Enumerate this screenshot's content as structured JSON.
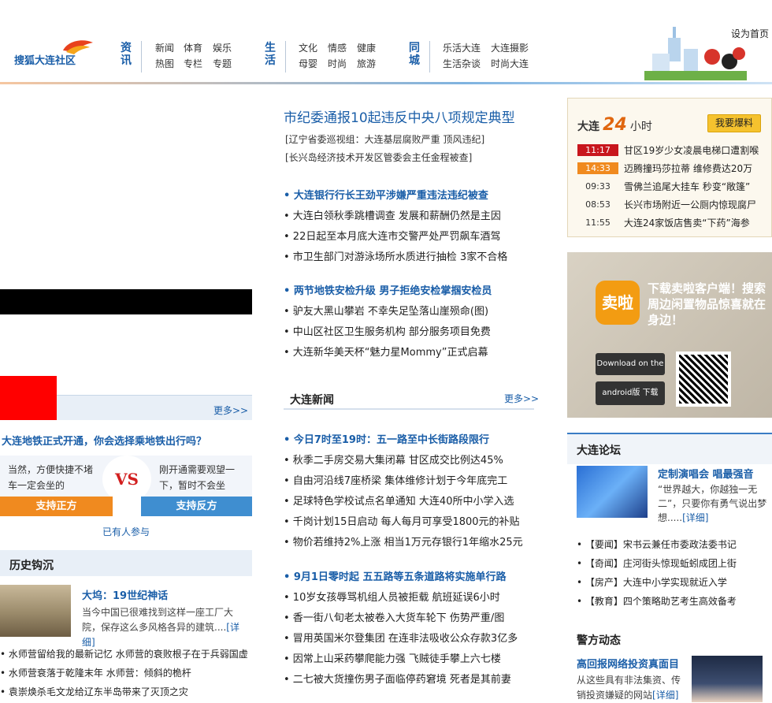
{
  "header": {
    "set_home": "设为首页",
    "logo_text": "搜狐大连社区",
    "categories": [
      {
        "title": "资讯",
        "links": [
          "新闻",
          "体育",
          "娱乐",
          "热图",
          "专栏",
          "专题"
        ]
      },
      {
        "title": "生活",
        "links": [
          "文化",
          "情感",
          "健康",
          "母婴",
          "时尚",
          "旅游"
        ]
      },
      {
        "title": "同城",
        "links": [
          "乐活大连",
          "大连摄影",
          "生活杂谈",
          "时尚大连"
        ]
      }
    ]
  },
  "poll": {
    "more": "更多>>",
    "question": "大连地铁正式开通，你会选择乘地铁出行吗？",
    "option_a": "当然，方便快捷不堵车一定会坐的",
    "option_b": "刚开通需要观望一下，暂时不会坐",
    "vs": "VS",
    "btn_pro": "支持正方",
    "btn_con": "支持反方",
    "count": "已有人参与"
  },
  "history": {
    "title": "历史钩沉",
    "head": "大坞：19世纪神话",
    "desc": "当今中国已很难找到这样一座工厂大院，保存这么多风格各异的建筑....",
    "detail": "[详细]",
    "items": [
      "• 水师营留给我的最新记忆 水师营的衰败根子在于兵弱国虚",
      "• 水师营衰落于乾隆末年 水师营：倾斜的桅杆",
      "• 袁崇焕杀毛文龙给辽东半岛带来了灭顶之灾"
    ]
  },
  "main": {
    "headline": "市纪委通报10起违反中央八项规定典型",
    "subs": [
      "[辽宁省委巡视组：大连基层腐败严重 顶风违纪]",
      "[长兴岛经济技术开发区管委会主任金程被查]"
    ],
    "group1": [
      {
        "text": "• 大连银行行长王劲平涉嫌严重违法违纪被查",
        "hl": true
      },
      {
        "text": "• 大连白领秋季跳槽调查 发展和薪酬仍然是主因",
        "hl": false
      },
      {
        "text": "• 22日起至本月底大连市交警严处严罚飙车酒驾",
        "hl": false
      },
      {
        "text": "• 市卫生部门对游泳场所水质进行抽检 3家不合格",
        "hl": false
      }
    ],
    "group2": [
      {
        "text": "• 两节地铁安检升级 男子拒绝安检掌掴安检员",
        "hl": true
      },
      {
        "text": "• 驴友大黑山攀岩 不幸失足坠落山崖殒命(图)",
        "hl": false
      },
      {
        "text": "• 中山区社区卫生服务机构 部分服务项目免费",
        "hl": false
      },
      {
        "text": "• 大连新华美天杯“魅力星Mommy”正式启幕",
        "hl": false
      }
    ],
    "dalian_news_title": "大连新闻",
    "dalian_news_more": "更多>>",
    "group3": [
      {
        "text": "• 今日7时至19时：五一路至中长街路段限行",
        "hl": true
      },
      {
        "text": "• 秋季二手房交易大集闭幕 甘区成交比例达45%",
        "hl": false
      },
      {
        "text": "• 自由河沿线7座桥梁 集体维修计划于今年底完工",
        "hl": false
      },
      {
        "text": "• 足球特色学校试点名单通知 大连40所中小学入选",
        "hl": false
      },
      {
        "text": "• 千岗计划15日启动 每人每月可享受1800元的补贴",
        "hl": false
      },
      {
        "text": "• 物价若维持2%上涨 相当1万元存银行1年缩水25元",
        "hl": false
      }
    ],
    "group4": [
      {
        "text": "• 9月1日零时起 五五路等五条道路将实施单行路",
        "hl": true
      },
      {
        "text": "• 10岁女孩辱骂机组人员被拒载 航班延误6小时",
        "hl": false
      },
      {
        "text": "• 香一街八旬老太被卷入大货车轮下 伤势严重/图",
        "hl": false
      },
      {
        "text": "• 冒用英国米尔登集团 在连非法吸收公众存款3亿多",
        "hl": false
      },
      {
        "text": "• 因常上山采药攀爬能力强 飞贼徒手攀上六七楼",
        "hl": false
      },
      {
        "text": "• 二七被大货撞伤男子面临停药窘境 死者是其前妻",
        "hl": false
      }
    ]
  },
  "box24": {
    "prefix": "大连",
    "number": "24",
    "suffix": "小时",
    "baoliao": "我要爆料",
    "news": [
      {
        "time": "11:17",
        "style": "red",
        "text": "甘区19岁少女凌晨电梯口遭割喉"
      },
      {
        "time": "14:33",
        "style": "orange",
        "text": "迈腾撞玛莎拉蒂 维修费达20万"
      },
      {
        "time": "09:33",
        "style": "plain",
        "text": "雪佛兰追尾大挂车 秒变“敞篷”"
      },
      {
        "time": "08:53",
        "style": "plain",
        "text": "长兴市场附近一公厕内惊现腐尸"
      },
      {
        "time": "11:55",
        "style": "plain",
        "text": "大连24家饭店售卖“下药”海参"
      }
    ]
  },
  "app_ad": {
    "icon_label": "卖啦",
    "text": "下载卖啦客户端！搜索周边闲置物品惊喜就在身边！",
    "appstore": "Download on the App Store",
    "android": "android版 下载"
  },
  "forum": {
    "title": "大连论坛",
    "head": "定制演唱会 唱最强音",
    "desc": "“世界越大，你越独一无二”，只要你有勇气说出梦想.....",
    "detail": "[详细]",
    "items": [
      "• 【要闻】宋书云兼任市委政法委书记",
      "• 【奇闻】庄河街头惊现蚯蚓成团上街",
      "• 【房产】大连中小学实现就近入学",
      "• 【教育】四个策略助艺考生高效备考"
    ]
  },
  "police": {
    "title": "警方动态",
    "head": "高回报网络投资真面目",
    "desc": "从这些具有非法集资、传销投资嫌疑的网站",
    "detail": "[详细]"
  }
}
